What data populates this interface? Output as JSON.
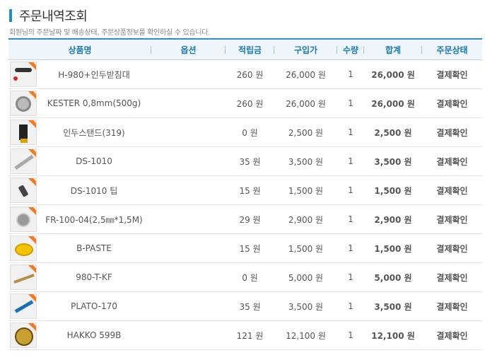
{
  "page": {
    "title": "주문내역조회",
    "description": "회원님의 주문날짜 및 배송상태, 주문상품정보를 확인하실 수 있습니다."
  },
  "table": {
    "headers": {
      "product": "상품명",
      "option": "옵션",
      "points": "적립금",
      "price": "구입가",
      "qty": "수량",
      "total": "합계",
      "status": "주문상태"
    },
    "rows": [
      {
        "name": "H-980+인두받침대",
        "option": "",
        "points": "260 원",
        "price": "26,000 원",
        "qty": "1",
        "total": "26,000 원",
        "status": "결제확인",
        "thumb_icon": "soldering-station-icon"
      },
      {
        "name": "KESTER 0,8mm(500g)",
        "option": "",
        "points": "260 원",
        "price": "26,000 원",
        "qty": "1",
        "total": "26,000 원",
        "status": "결제확인",
        "thumb_icon": "solder-reel-icon"
      },
      {
        "name": "인두스탠드(319)",
        "option": "",
        "points": "0 원",
        "price": "2,500 원",
        "qty": "1",
        "total": "2,500 원",
        "status": "결제확인",
        "thumb_icon": "iron-stand-icon"
      },
      {
        "name": "DS-1010",
        "option": "",
        "points": "35 원",
        "price": "3,500 원",
        "qty": "1",
        "total": "3,500 원",
        "status": "결제확인",
        "thumb_icon": "desoldering-pump-icon"
      },
      {
        "name": "DS-1010 팁",
        "option": "",
        "points": "15 원",
        "price": "1,500 원",
        "qty": "1",
        "total": "1,500 원",
        "status": "결제확인",
        "thumb_icon": "pump-tip-icon"
      },
      {
        "name": "FR-100-04(2,5㎜*1,5M)",
        "option": "",
        "points": "29 원",
        "price": "2,900 원",
        "qty": "1",
        "total": "2,900 원",
        "status": "결제확인",
        "thumb_icon": "wick-reel-icon"
      },
      {
        "name": "B-PASTE",
        "option": "",
        "points": "15 원",
        "price": "1,500 원",
        "qty": "1",
        "total": "1,500 원",
        "status": "결제확인",
        "thumb_icon": "paste-tin-icon"
      },
      {
        "name": "980-T-KF",
        "option": "",
        "points": "0 원",
        "price": "5,000 원",
        "qty": "1",
        "total": "5,000 원",
        "status": "결제확인",
        "thumb_icon": "iron-tip-icon"
      },
      {
        "name": "PLATO-170",
        "option": "",
        "points": "35 원",
        "price": "3,500 원",
        "qty": "1",
        "total": "3,500 원",
        "status": "결제확인",
        "thumb_icon": "cutter-icon"
      },
      {
        "name": "HAKKO 599B",
        "option": "",
        "points": "121 원",
        "price": "12,100 원",
        "qty": "1",
        "total": "12,100 원",
        "status": "결제확인",
        "thumb_icon": "tip-cleaner-icon"
      }
    ]
  },
  "colors": {
    "accent": "#1b8fc0",
    "header_text": "#1a79b0",
    "total_text": "#e0531a",
    "tag": "#f07c24"
  }
}
